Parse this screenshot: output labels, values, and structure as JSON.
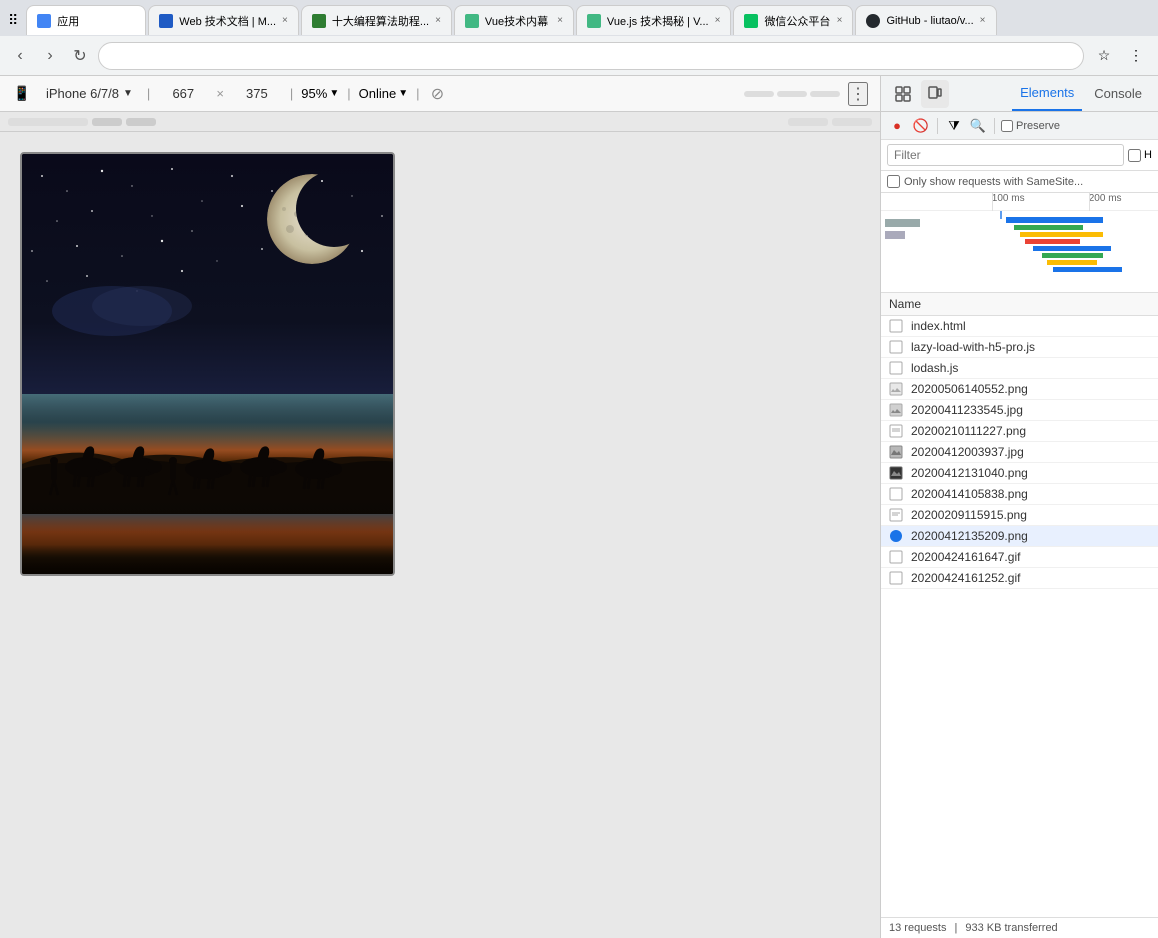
{
  "browser": {
    "tabs": [
      {
        "id": 1,
        "label": "应用",
        "favicon_color": "#4285f4"
      },
      {
        "id": 2,
        "label": "Web 技术文档 | M...",
        "favicon_color": "#1f5bc4"
      },
      {
        "id": 3,
        "label": "十大编程算法助程...",
        "favicon_color": "#2e7d32"
      },
      {
        "id": 4,
        "label": "Vue技术内幕",
        "favicon_color": "#41b883"
      },
      {
        "id": 5,
        "label": "Vue.js 技术揭秘 | V...",
        "favicon_color": "#41b883"
      },
      {
        "id": 6,
        "label": "微信公众平台",
        "favicon_color": "#07c160"
      },
      {
        "id": 7,
        "label": "GitHub - liutao/v...",
        "favicon_color": "#24292e"
      }
    ],
    "address": ""
  },
  "device_toolbar": {
    "device_name": "iPhone 6/7/8",
    "width": "667",
    "height_val": "375",
    "zoom": "95%",
    "online": "Online"
  },
  "devtools": {
    "tabs": [
      "Elements",
      "Console"
    ],
    "active_tab": "Elements",
    "network_toolbar": {
      "preserve_label": "Preserve"
    },
    "filter": {
      "placeholder": "Filter",
      "only_same_site": "Only show requests with SameSite..."
    },
    "timeline": {
      "markers": [
        "100 ms",
        "200 ms"
      ]
    },
    "name_column_header": "Name",
    "files": [
      {
        "name": "index.html",
        "icon": "html",
        "selected": false
      },
      {
        "name": "lazy-load-with-h5-pro.js",
        "icon": "js",
        "selected": false
      },
      {
        "name": "lodash.js",
        "icon": "js",
        "selected": false
      },
      {
        "name": "20200506140552.png",
        "icon": "png",
        "selected": false
      },
      {
        "name": "20200411233545.jpg",
        "icon": "jpg",
        "selected": false
      },
      {
        "name": "20200210111227.png",
        "icon": "png",
        "selected": false
      },
      {
        "name": "20200412003937.jpg",
        "icon": "jpg",
        "selected": false
      },
      {
        "name": "20200412131040.png",
        "icon": "png-dark",
        "selected": false
      },
      {
        "name": "20200414105838.png",
        "icon": "png",
        "selected": false
      },
      {
        "name": "20200209115915.png",
        "icon": "png",
        "selected": false
      },
      {
        "name": "20200412135209.png",
        "icon": "png-blue",
        "selected": true
      },
      {
        "name": "20200424161647.gif",
        "icon": "gif",
        "selected": false
      },
      {
        "name": "20200424161252.gif",
        "icon": "gif",
        "selected": false
      }
    ],
    "status": {
      "requests": "13 requests",
      "transferred": "933 KB transferred"
    }
  }
}
